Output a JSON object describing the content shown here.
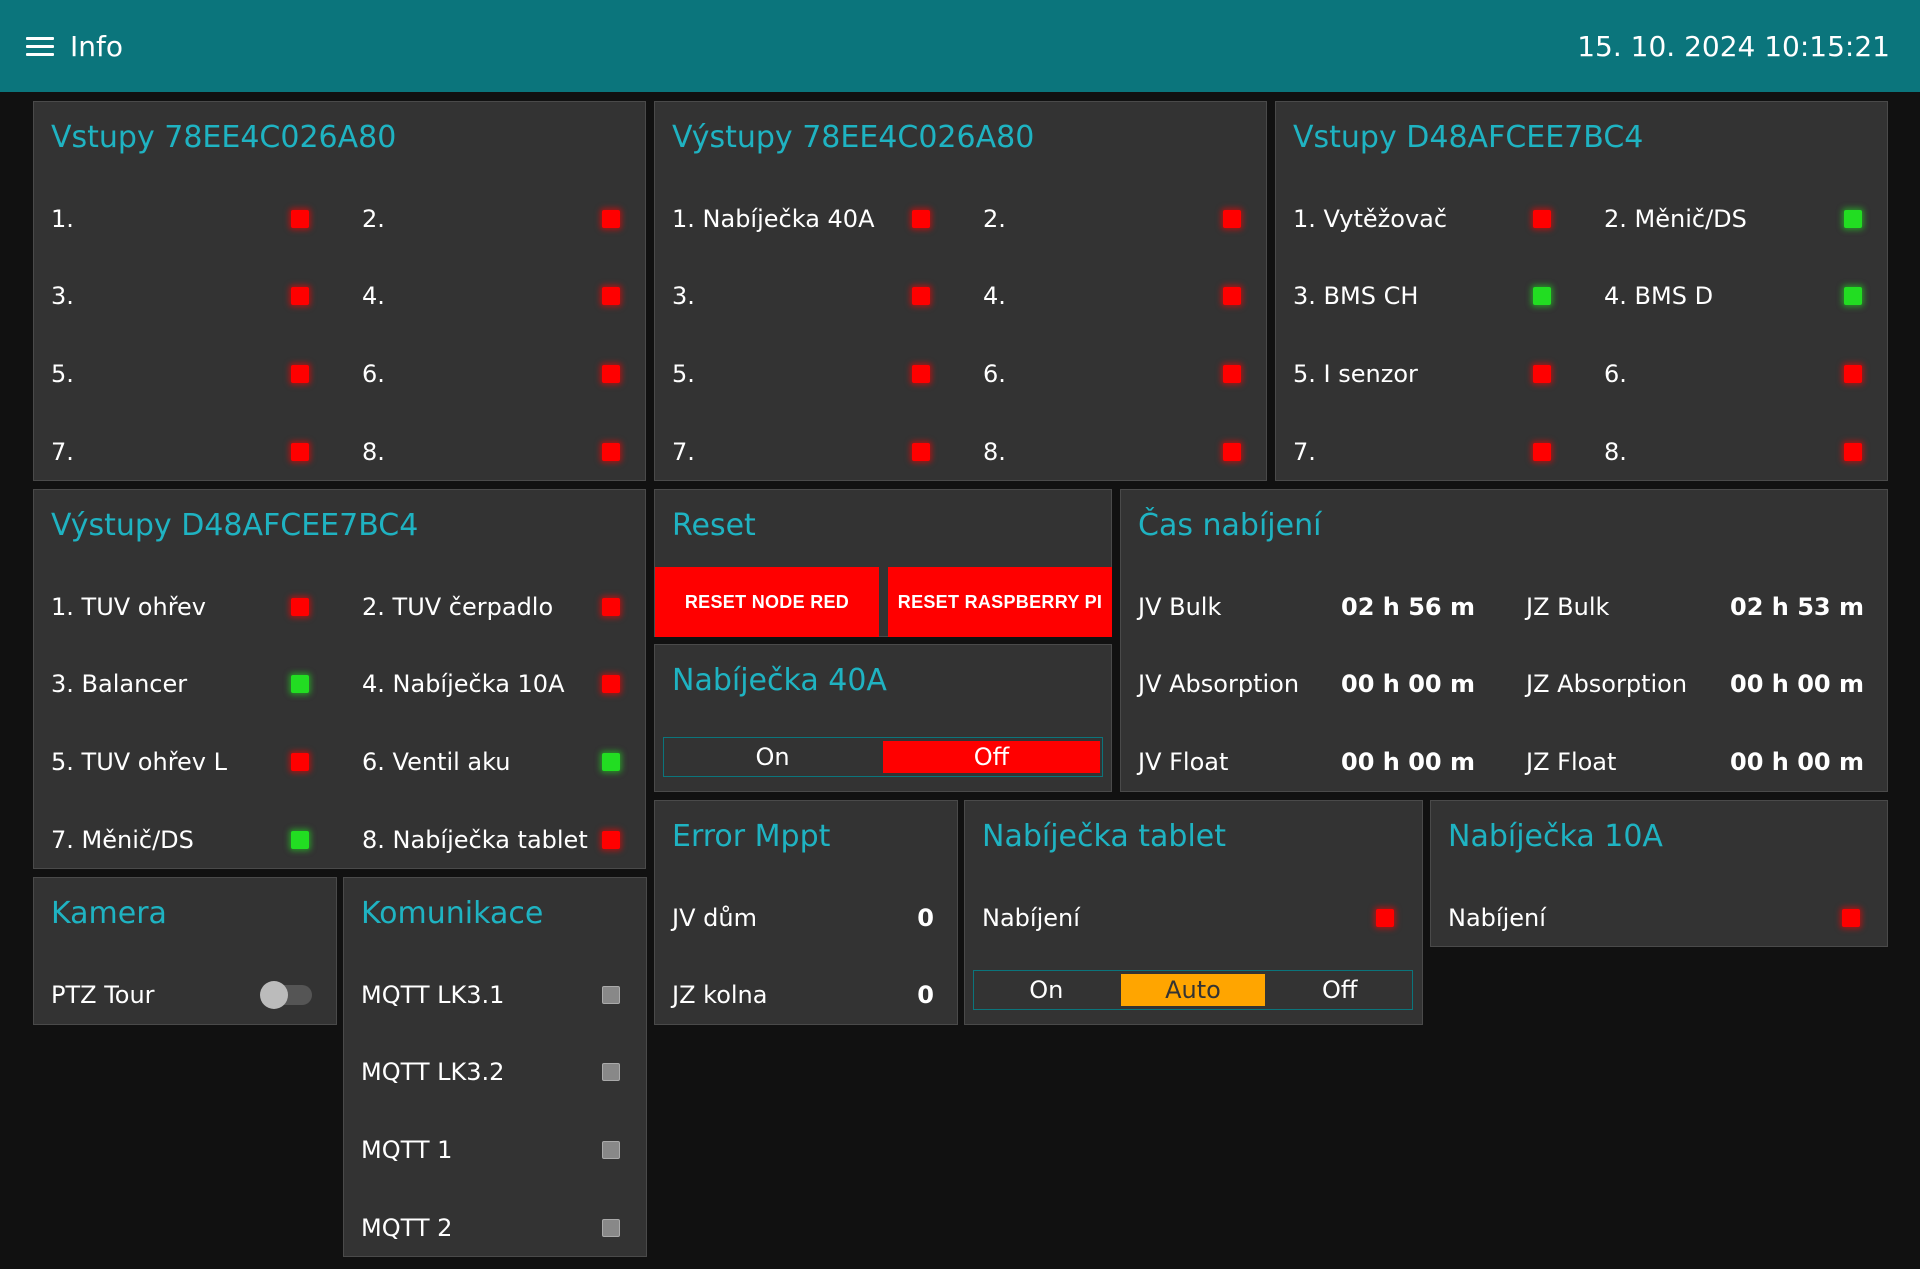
{
  "header": {
    "title": "Info",
    "datetime": "15. 10. 2024 10:15:21"
  },
  "cards": {
    "vstupy1": {
      "title": "Vstupy 78EE4C026A80",
      "items": [
        {
          "label": "1.",
          "state": "red"
        },
        {
          "label": "2.",
          "state": "red"
        },
        {
          "label": "3.",
          "state": "red"
        },
        {
          "label": "4.",
          "state": "red"
        },
        {
          "label": "5.",
          "state": "red"
        },
        {
          "label": "6.",
          "state": "red"
        },
        {
          "label": "7.",
          "state": "red"
        },
        {
          "label": "8.",
          "state": "red"
        }
      ]
    },
    "vystupy1": {
      "title": "Výstupy 78EE4C026A80",
      "items": [
        {
          "label": "1. Nabíječka 40A",
          "state": "red"
        },
        {
          "label": "2.",
          "state": "red"
        },
        {
          "label": "3.",
          "state": "red"
        },
        {
          "label": "4.",
          "state": "red"
        },
        {
          "label": "5.",
          "state": "red"
        },
        {
          "label": "6.",
          "state": "red"
        },
        {
          "label": "7.",
          "state": "red"
        },
        {
          "label": "8.",
          "state": "red"
        }
      ]
    },
    "vstupy2": {
      "title": "Vstupy D48AFCEE7BC4",
      "items": [
        {
          "label": "1. Vytěžovač",
          "state": "red"
        },
        {
          "label": "2. Měnič/DS",
          "state": "green"
        },
        {
          "label": "3. BMS CH",
          "state": "green"
        },
        {
          "label": "4. BMS D",
          "state": "green"
        },
        {
          "label": "5. I senzor",
          "state": "red"
        },
        {
          "label": "6.",
          "state": "red"
        },
        {
          "label": "7.",
          "state": "red"
        },
        {
          "label": "8.",
          "state": "red"
        }
      ]
    },
    "vystupy2": {
      "title": "Výstupy D48AFCEE7BC4",
      "items": [
        {
          "label": "1. TUV ohřev",
          "state": "red"
        },
        {
          "label": "2. TUV čerpadlo",
          "state": "red"
        },
        {
          "label": "3. Balancer",
          "state": "green"
        },
        {
          "label": "4. Nabíječka 10A",
          "state": "red"
        },
        {
          "label": "5. TUV ohřev L",
          "state": "red"
        },
        {
          "label": "6. Ventil aku",
          "state": "green"
        },
        {
          "label": "7. Měnič/DS",
          "state": "green"
        },
        {
          "label": "8. Nabíječka tablet",
          "state": "red"
        }
      ]
    },
    "reset": {
      "title": "Reset",
      "btn_node_red": "RESET NODE RED",
      "btn_raspberry": "RESET RASPBERRY PI"
    },
    "nab40": {
      "title": "Nabíječka 40A",
      "options": [
        "On",
        "Off"
      ],
      "selected": "Off"
    },
    "cas": {
      "title": "Čas nabíjení",
      "rows": [
        {
          "l1": "JV Bulk",
          "v1": "02 h 56 m",
          "l2": "JZ Bulk",
          "v2": "02 h 53 m"
        },
        {
          "l1": "JV Absorption",
          "v1": "00 h 00 m",
          "l2": "JZ Absorption",
          "v2": "00 h 00 m"
        },
        {
          "l1": "JV Float",
          "v1": "00 h 00 m",
          "l2": "JZ Float",
          "v2": "00 h 00 m"
        }
      ]
    },
    "error": {
      "title": "Error Mppt",
      "rows": [
        {
          "label": "JV dům",
          "value": "0"
        },
        {
          "label": "JZ kolna",
          "value": "0"
        }
      ]
    },
    "tablet": {
      "title": "Nabíječka tablet",
      "label": "Nabíjení",
      "state": "red",
      "options": [
        "On",
        "Auto",
        "Off"
      ],
      "selected": "Auto"
    },
    "nab10": {
      "title": "Nabíječka 10A",
      "label": "Nabíjení",
      "state": "red"
    },
    "kamera": {
      "title": "Kamera",
      "label": "PTZ Tour",
      "toggle_on": false
    },
    "komunikace": {
      "title": "Komunikace",
      "items": [
        {
          "label": "MQTT LK3.1",
          "state": "gray"
        },
        {
          "label": "MQTT LK3.2",
          "state": "gray"
        },
        {
          "label": "MQTT 1",
          "state": "gray"
        },
        {
          "label": "MQTT 2",
          "state": "gray"
        }
      ]
    }
  },
  "colors": {
    "header": "#0b757c",
    "accent": "#1fb3c2",
    "card": "#333333",
    "led_red": "#ff0000",
    "led_green": "#22dd22",
    "amber": "#ffa500"
  }
}
